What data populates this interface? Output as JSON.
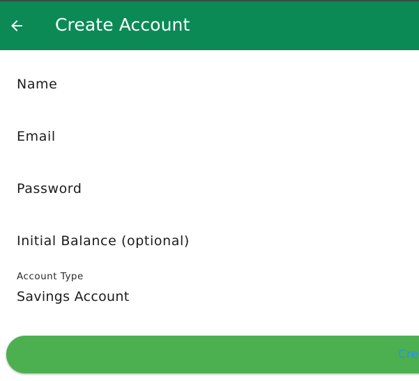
{
  "colors": {
    "app_bar": "#0b8a56",
    "button": "#4caf50",
    "button_text": "#2196f3"
  },
  "app_bar": {
    "back_icon": "arrow-left-icon",
    "title": "Create Account"
  },
  "form": {
    "name_label": "Name",
    "email_label": "Email",
    "password_label": "Password",
    "balance_label": "Initial Balance (optional)",
    "account_type_label": "Account Type",
    "account_type_value": "Savings Account"
  },
  "actions": {
    "create_label": "Create"
  }
}
